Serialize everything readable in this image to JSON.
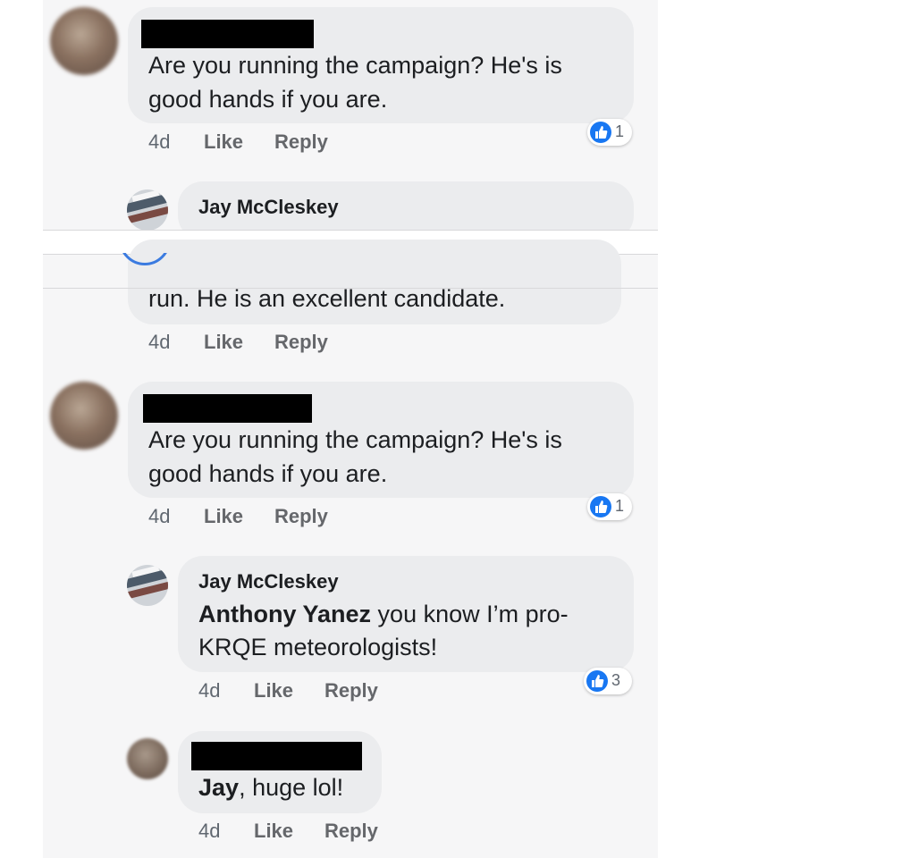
{
  "comments": [
    {
      "text_line1": "Are you running the campaign? He's is",
      "text_line2": "good hands if you are.",
      "time": "4d",
      "like": "Like",
      "reply": "Reply",
      "reactions": "1"
    },
    {
      "author": "Jay McCleskey",
      "text_line1": "run.  He is an excellent candidate.",
      "time": "4d",
      "like": "Like",
      "reply": "Reply"
    },
    {
      "text_line1": "Are you running the campaign? He's is",
      "text_line2": "good hands if you are.",
      "time": "4d",
      "like": "Like",
      "reply": "Reply",
      "reactions": "1"
    },
    {
      "author": "Jay McCleskey",
      "mention": "Anthony Yanez",
      "text_rest": " you know I’m pro-",
      "text_line2": "KRQE meteorologists!",
      "time": "4d",
      "like": "Like",
      "reply": "Reply",
      "reactions": "3"
    },
    {
      "mention": "Jay",
      "text_rest": ", huge lol!",
      "time": "4d",
      "like": "Like",
      "reply": "Reply"
    }
  ],
  "icons": {
    "reaction": "thumbs-up-icon",
    "redaction": "redaction-bar"
  },
  "colors": {
    "bubble": "#ebecee",
    "like_blue": "#1877f2",
    "meta": "#65676b"
  }
}
